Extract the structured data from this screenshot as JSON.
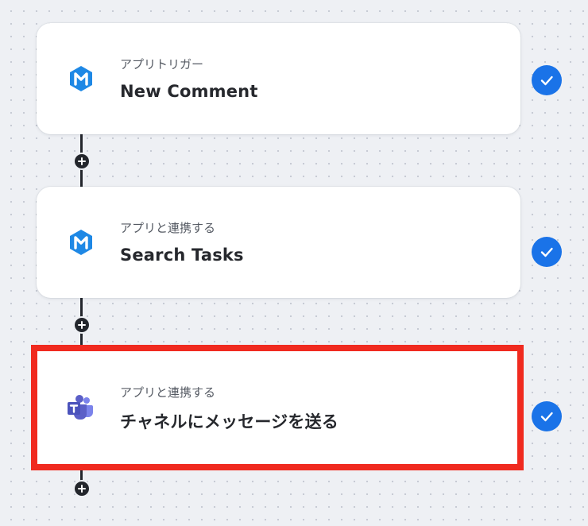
{
  "workflow": {
    "steps": [
      {
        "kind_label": "アプリトリガー",
        "title": "New Comment",
        "app_icon": "meistertask-icon",
        "status": "completed",
        "highlighted": false
      },
      {
        "kind_label": "アプリと連携する",
        "title": "Search Tasks",
        "app_icon": "meistertask-icon",
        "status": "completed",
        "highlighted": false
      },
      {
        "kind_label": "アプリと連携する",
        "title": "チャネルにメッセージを送る",
        "app_icon": "microsoft-teams-icon",
        "status": "completed",
        "highlighted": true
      }
    ],
    "add_step_icon": "plus-icon",
    "colors": {
      "check": "#1a73e8",
      "highlight_border": "#f02a1f",
      "meistertask": "#1e88e5",
      "teams": "#5b5fc7"
    }
  }
}
